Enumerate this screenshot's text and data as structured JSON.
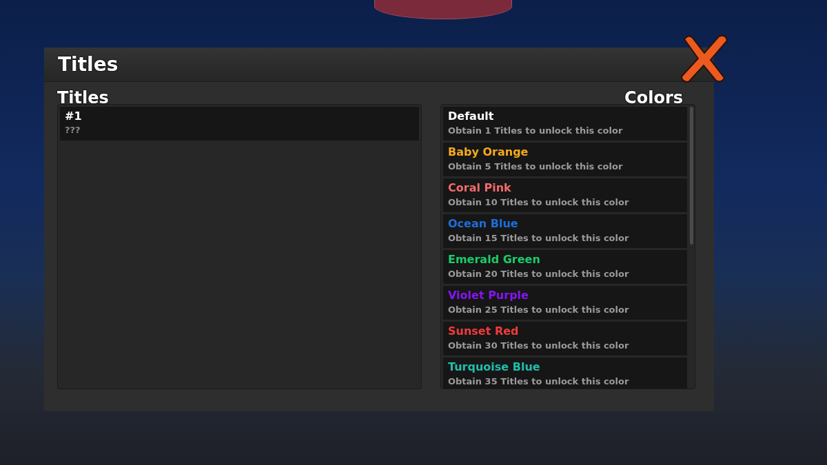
{
  "window": {
    "title": "Titles"
  },
  "titles_panel": {
    "heading": "Titles",
    "items": [
      {
        "name": "#1",
        "description": "???"
      }
    ]
  },
  "colors_panel": {
    "heading": "Colors",
    "items": [
      {
        "name": "Default",
        "color": "#ffffff",
        "requirement": "Obtain 1 Titles to unlock this color"
      },
      {
        "name": "Baby Orange",
        "color": "#f5a91c",
        "requirement": "Obtain 5 Titles to unlock this color"
      },
      {
        "name": "Coral Pink",
        "color": "#f06b6b",
        "requirement": "Obtain 10 Titles to unlock this color"
      },
      {
        "name": "Ocean Blue",
        "color": "#1e6fd9",
        "requirement": "Obtain 15 Titles to unlock this color"
      },
      {
        "name": "Emerald Green",
        "color": "#1ccc68",
        "requirement": "Obtain 20 Titles to unlock this color"
      },
      {
        "name": "Violet Purple",
        "color": "#8614f2",
        "requirement": "Obtain 25 Titles to unlock this color"
      },
      {
        "name": "Sunset Red",
        "color": "#f23b3b",
        "requirement": "Obtain 30 Titles to unlock this color"
      },
      {
        "name": "Turquoise Blue",
        "color": "#1ebfae",
        "requirement": "Obtain 35 Titles to unlock this color"
      }
    ]
  }
}
